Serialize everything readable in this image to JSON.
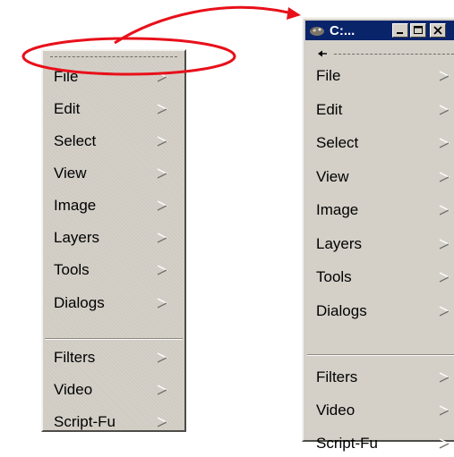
{
  "left_menu": {
    "items": [
      {
        "label": "File"
      },
      {
        "label": "Edit"
      },
      {
        "label": "Select"
      },
      {
        "label": "View"
      },
      {
        "label": "Image"
      },
      {
        "label": "Layers"
      },
      {
        "label": "Tools"
      },
      {
        "label": "Dialogs"
      },
      {
        "label": "Filters"
      },
      {
        "label": "Video"
      },
      {
        "label": "Script-Fu"
      }
    ]
  },
  "window": {
    "title": "C:...",
    "items": [
      {
        "label": "File"
      },
      {
        "label": "Edit"
      },
      {
        "label": "Select"
      },
      {
        "label": "View"
      },
      {
        "label": "Image"
      },
      {
        "label": "Layers"
      },
      {
        "label": "Tools"
      },
      {
        "label": "Dialogs"
      },
      {
        "label": "Filters"
      },
      {
        "label": "Video"
      },
      {
        "label": "Script-Fu"
      }
    ]
  },
  "colors": {
    "annotation_red": "#e8101a",
    "menu_background": "#d4d0c8",
    "titlebar_background": "#0a246a"
  },
  "icons": {
    "submenu_arrow": "submenu-arrow-icon",
    "window_app": "gimp-wilber-icon",
    "minimize": "minimize-icon",
    "maximize": "maximize-icon",
    "close": "close-icon"
  }
}
